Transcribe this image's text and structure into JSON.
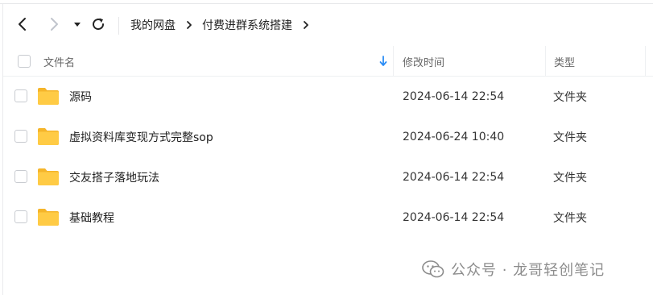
{
  "breadcrumb": {
    "items": [
      "我的网盘",
      "付费进群系统搭建"
    ]
  },
  "table": {
    "columns": {
      "name": "文件名",
      "modified": "修改时间",
      "type": "类型"
    },
    "rows": [
      {
        "name": "源码",
        "modified": "2024-06-14 22:54",
        "type": "文件夹",
        "icon": "folder-icon"
      },
      {
        "name": "虚拟资料库变现方式完整sop",
        "modified": "2024-06-24 10:40",
        "type": "文件夹",
        "icon": "folder-icon"
      },
      {
        "name": "交友搭子落地玩法",
        "modified": "2024-06-14 22:54",
        "type": "文件夹",
        "icon": "folder-icon"
      },
      {
        "name": "基础教程",
        "modified": "2024-06-14 22:54",
        "type": "文件夹",
        "icon": "folder-icon"
      }
    ]
  },
  "watermark": {
    "text": "公众号 · 龙哥轻创笔记"
  },
  "colors": {
    "folder": "#ffc93d",
    "sort_arrow": "#2a8cf5",
    "icon_dark": "#222222",
    "icon_disabled": "#c0c4cc",
    "watermark": "#8c8c8c"
  }
}
